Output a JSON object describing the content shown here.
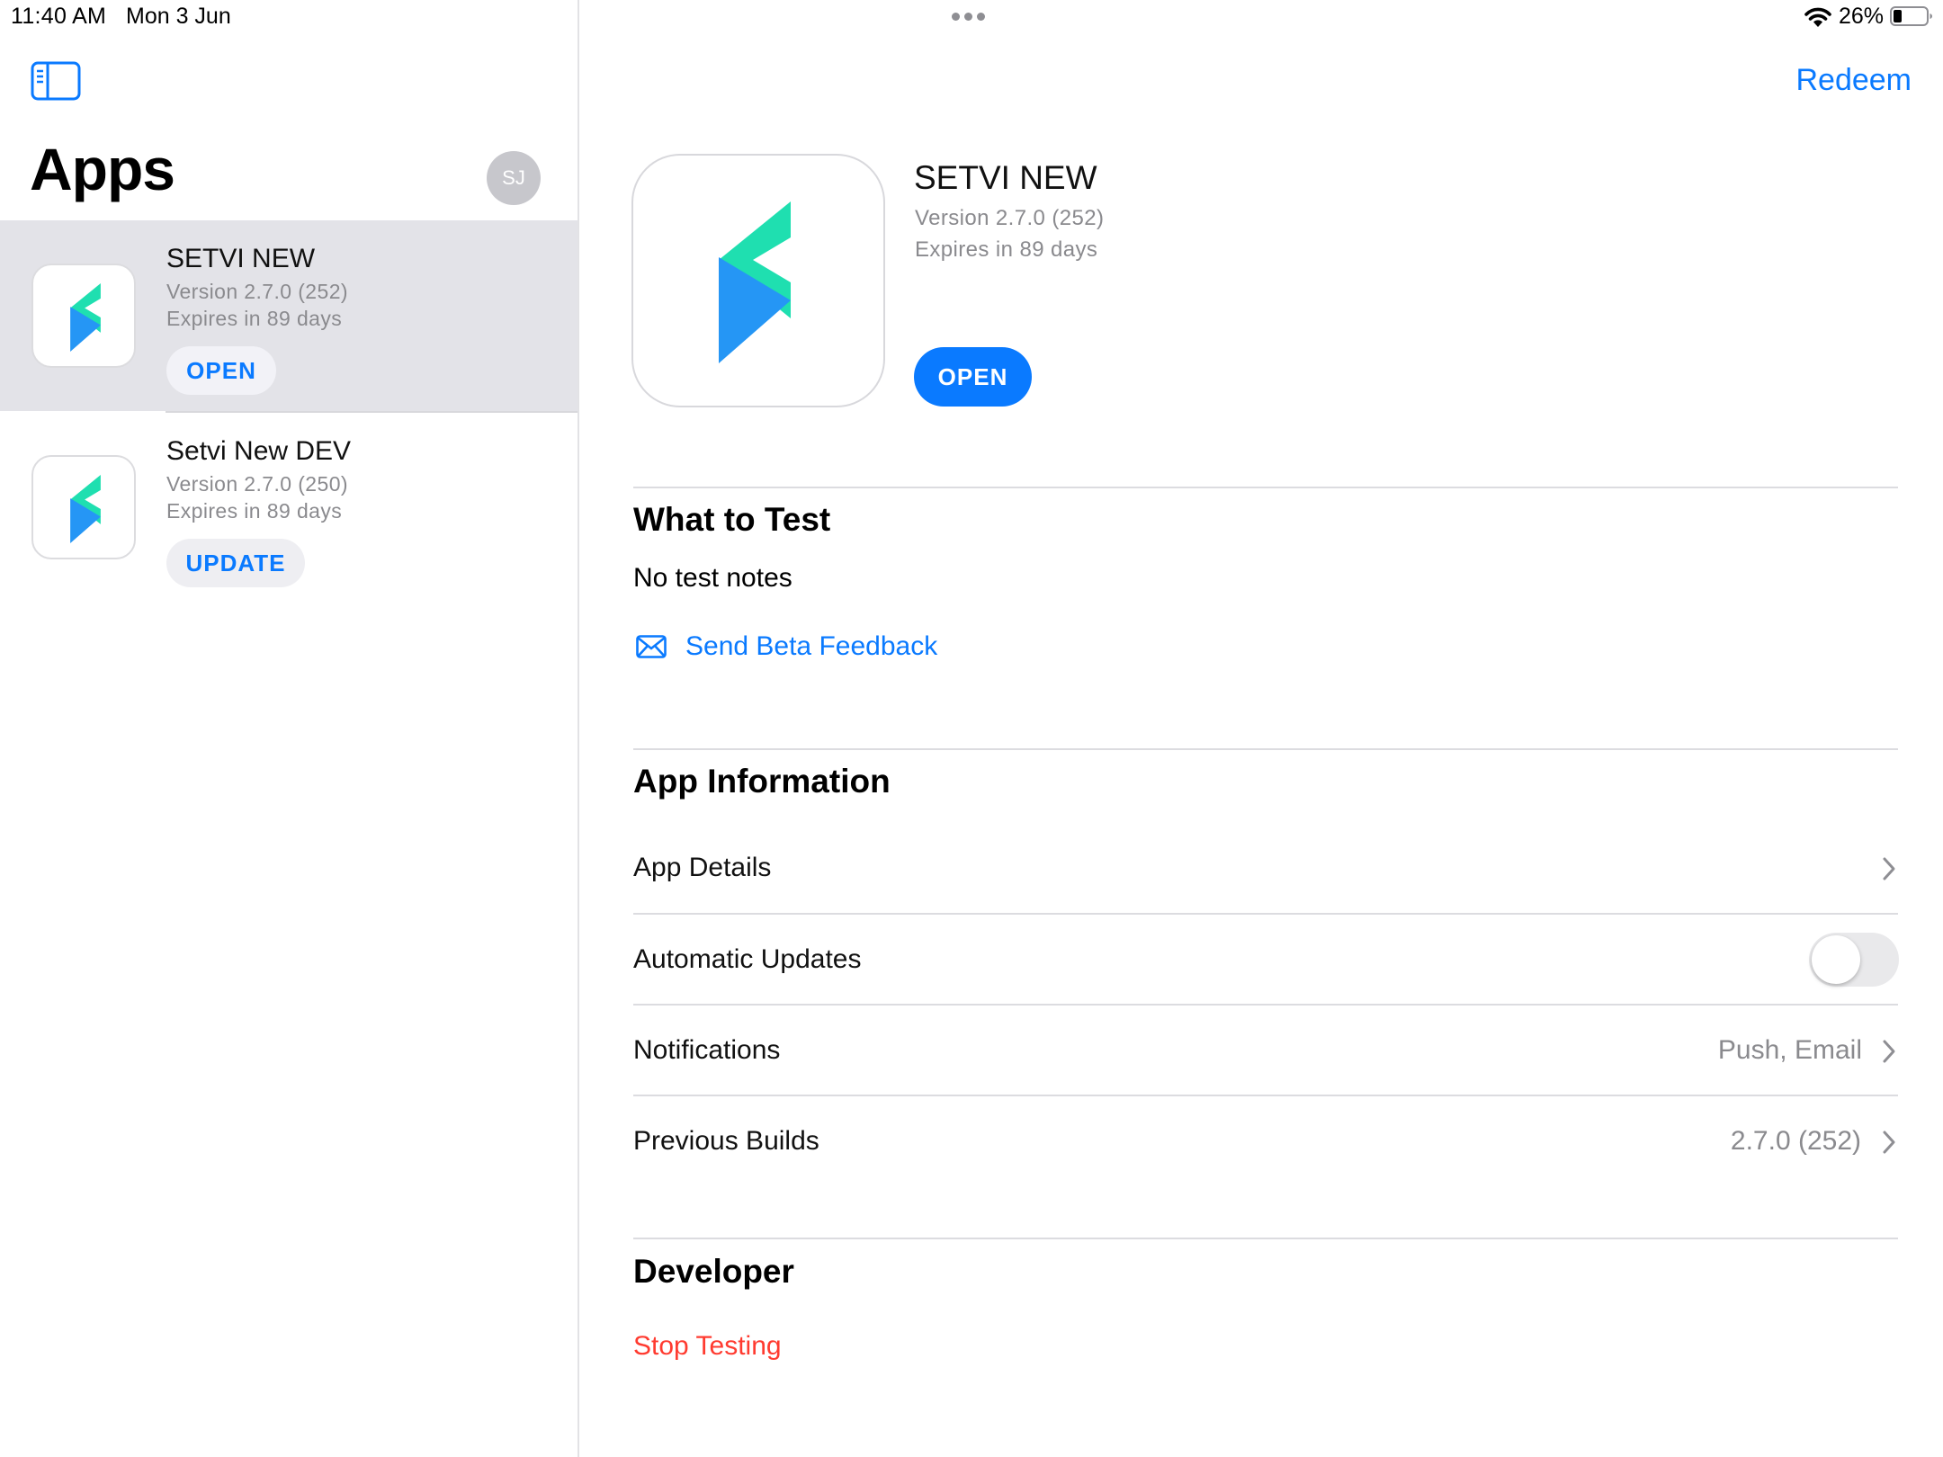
{
  "status_bar": {
    "time": "11:40 AM",
    "date": "Mon 3 Jun",
    "battery": "26%"
  },
  "sidebar": {
    "redeem_label": "Redeem",
    "title": "Apps",
    "avatar_initials": "SJ",
    "apps": [
      {
        "name": "SETVI NEW",
        "version": "Version 2.7.0 (252)",
        "expires": "Expires in 89 days",
        "action": "OPEN",
        "selected": true
      },
      {
        "name": "Setvi New DEV",
        "version": "Version 2.7.0 (250)",
        "expires": "Expires in 89 days",
        "action": "UPDATE",
        "selected": false
      }
    ]
  },
  "detail": {
    "name": "SETVI NEW",
    "version": "Version 2.7.0 (252)",
    "expires": "Expires in 89 days",
    "open_label": "OPEN",
    "what_to_test": {
      "heading": "What to Test",
      "notes": "No test notes",
      "feedback_label": "Send Beta Feedback"
    },
    "app_information": {
      "heading": "App Information",
      "rows": [
        {
          "label": "App Details",
          "value": ""
        },
        {
          "label": "Automatic Updates",
          "toggle_on": false
        },
        {
          "label": "Notifications",
          "value": "Push, Email"
        },
        {
          "label": "Previous Builds",
          "value": "2.7.0 (252)"
        }
      ]
    },
    "developer": {
      "heading": "Developer",
      "stop_label": "Stop Testing"
    }
  },
  "colors": {
    "accent": "#0a7aff",
    "danger": "#ff3b30",
    "icon_green": "#1fdfb0",
    "icon_blue": "#2596f5"
  },
  "icons": [
    "sidebar-toggle-icon",
    "wifi-icon",
    "battery-icon",
    "envelope-icon",
    "chevron-right-icon",
    "setvi-logo-icon"
  ]
}
